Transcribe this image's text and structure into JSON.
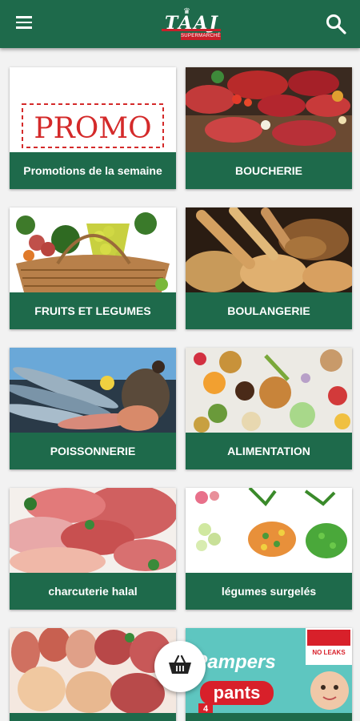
{
  "header": {
    "logo_text": "TAAJ",
    "logo_subtitle": "SUPERMARCHÉ",
    "menu_icon": "menu-icon",
    "search_icon": "search-icon",
    "brand_color": "#1e6a4b"
  },
  "categories": [
    {
      "label": "Promotions de la semaine",
      "image_text": "PROMO"
    },
    {
      "label": "BOUCHERIE"
    },
    {
      "label": "FRUITS ET LEGUMES"
    },
    {
      "label": "BOULANGERIE"
    },
    {
      "label": "POISSONNERIE"
    },
    {
      "label": "ALIMENTATION"
    },
    {
      "label": "charcuterie halal"
    },
    {
      "label": "légumes surgelés"
    },
    {
      "label": ""
    },
    {
      "label": "",
      "image_text": {
        "brand": "Pampers",
        "sub": "pants",
        "size": "4",
        "badge": "NO LEAKS"
      }
    }
  ],
  "cart_icon": "basket-icon"
}
